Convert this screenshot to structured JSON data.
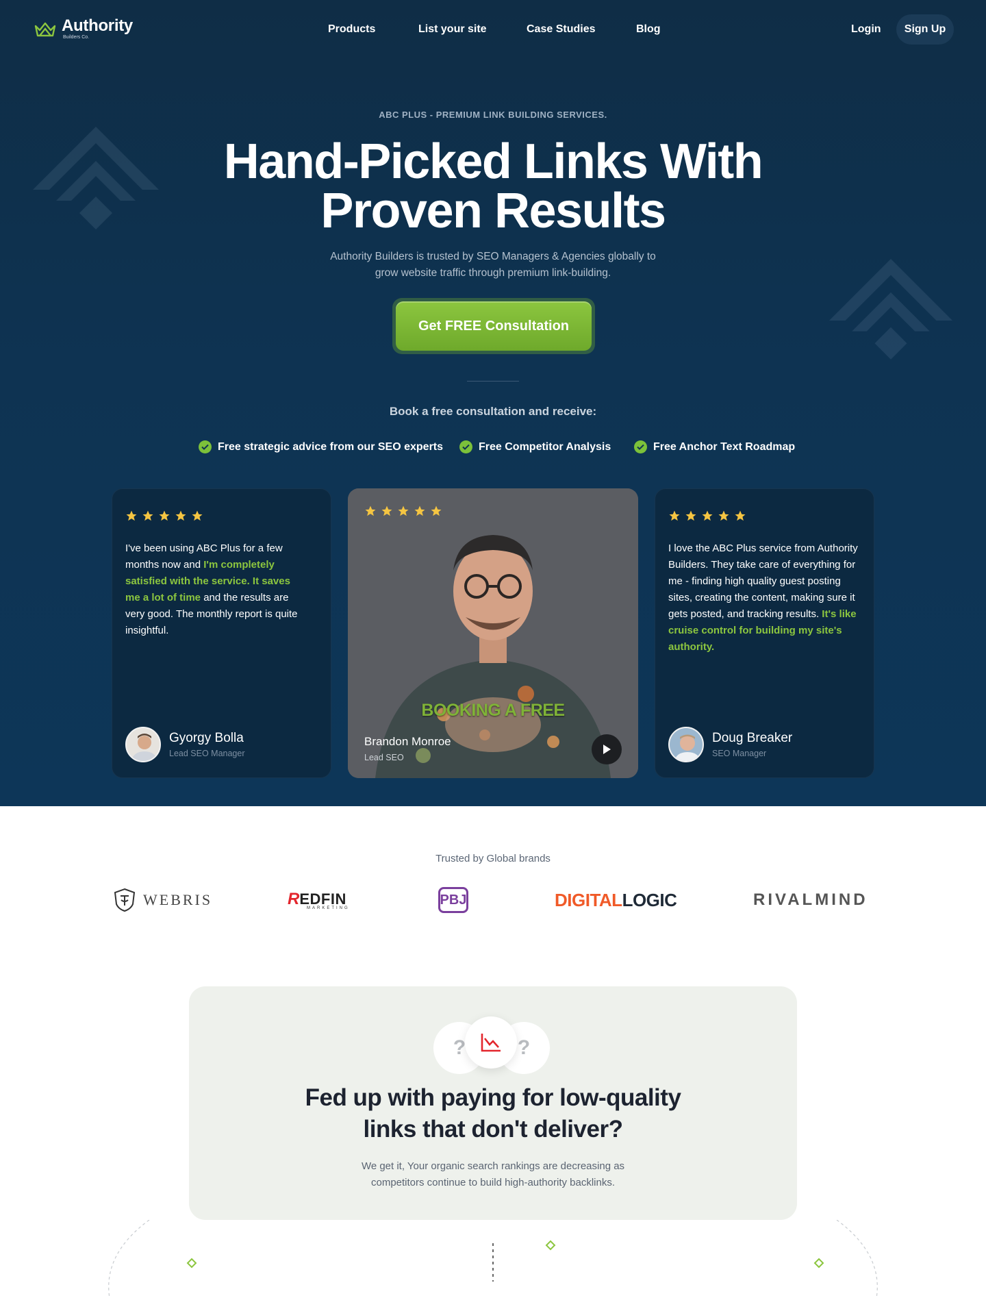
{
  "nav": {
    "logo_main": "Authority",
    "logo_sub": "Builders Co.",
    "links": [
      "Products",
      "List your site",
      "Case Studies",
      "Blog"
    ],
    "login": "Login",
    "signup": "Sign Up"
  },
  "hero": {
    "eyebrow": "ABC PLUS - PREMIUM LINK BUILDING SERVICES.",
    "headline_line1": "Hand-Picked Links With",
    "headline_line2": "Proven Results",
    "subline": "Authority Builders is trusted by SEO Managers & Agencies globally to grow website traffic through premium link-building.",
    "cta": "Get FREE Consultation",
    "book": "Book a free consultation and receive:",
    "benefits": [
      "Free strategic advice from our SEO experts",
      "Free Competitor Analysis",
      "Free Anchor Text Roadmap"
    ]
  },
  "testimonials": {
    "left": {
      "rating": 5,
      "q1": "I've been using ABC Plus for a few months now and ",
      "q_hl": "I'm completely satisfied with the service. It saves me a lot of time",
      "q2": " and the results are very good. The monthly report is quite insightful.",
      "name": "Gyorgy Bolla",
      "role": "Lead SEO Manager"
    },
    "video": {
      "rating": 5,
      "caption": "BOOKING A FREE",
      "name": "Brandon Monroe",
      "role": "Lead SEO"
    },
    "right": {
      "rating": 5,
      "q1": "I love the ABC Plus service from Authority Builders. They take care of everything for me - finding high quality guest posting sites, creating the content, making sure it gets posted, and tracking results. ",
      "q_hl": "It's like cruise control for building my site's authority.",
      "name": "Doug Breaker",
      "role": "SEO Manager"
    }
  },
  "trusted": {
    "label": "Trusted by Global brands",
    "brands": {
      "webris": "WEBRIS",
      "redfin_a": "R",
      "redfin_b": "EDFIN",
      "redfin_sub": "MARKETING",
      "pbj": "PBJ",
      "digital": "DIGITAL",
      "logic": "LOGIC",
      "rivalmind": "RIVALMIND"
    }
  },
  "problem": {
    "title_line1": "Fed up with paying for low-quality",
    "title_line2": "links that don't deliver?",
    "body": "We get it, Your organic search rankings are decreasing as competitors continue to build high-authority backlinks.",
    "q_mark": "?"
  },
  "colors": {
    "accent_green": "#8cc63f",
    "hero_bg": "#0e3352",
    "star": "#f5c542",
    "digital_orange": "#f05a28"
  }
}
